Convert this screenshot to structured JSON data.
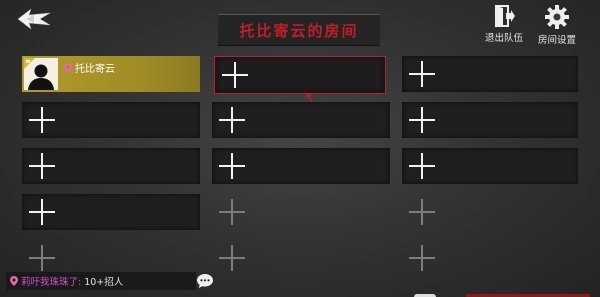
{
  "header": {
    "room_title": "托比寄云的房间",
    "leave_team_label": "退出队伍",
    "room_settings_label": "房间设置"
  },
  "player": {
    "name": "托比寄云"
  },
  "chat": {
    "sender": "莉吁我珠珠了:",
    "message": "10+招人"
  },
  "colors": {
    "title_red": "#c41e25",
    "player_slot_gold": "#b29c2c",
    "selected_border": "#c0202a",
    "chat_sender": "#d050c8"
  }
}
